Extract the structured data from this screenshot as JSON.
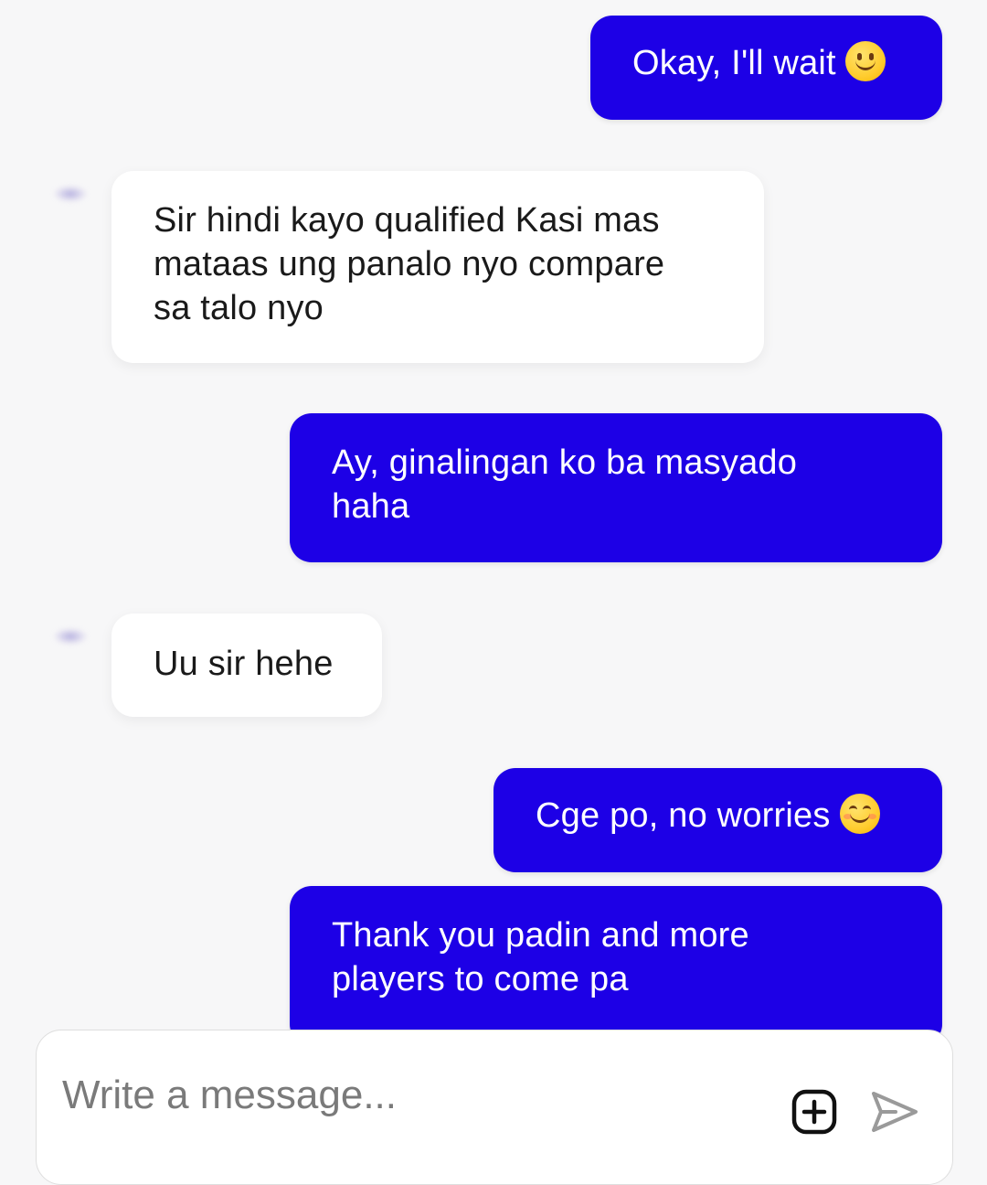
{
  "messages": [
    {
      "side": "out",
      "text": "Okay, I'll wait",
      "emoji": "slightly-smiling-face-icon"
    },
    {
      "side": "in",
      "lines": [
        "Sir hindi kayo qualified Kasi mas",
        "mataas ung panalo nyo compare",
        "sa talo nyo"
      ]
    },
    {
      "side": "out",
      "lines": [
        "Ay, ginalingan ko ba masyado",
        "haha"
      ]
    },
    {
      "side": "in",
      "text": "Uu sir hehe"
    },
    {
      "side": "out",
      "text": "Cge po, no worries",
      "emoji": "smiling-face-with-smiling-eyes-icon"
    },
    {
      "side": "out",
      "lines": [
        "Thank you padin and more",
        "players to come pa"
      ]
    }
  ],
  "composer": {
    "placeholder": "Write a message..."
  },
  "colors": {
    "outgoing_bubble": "#1d00e6",
    "incoming_bubble": "#ffffff",
    "background": "#f7f7f8"
  }
}
